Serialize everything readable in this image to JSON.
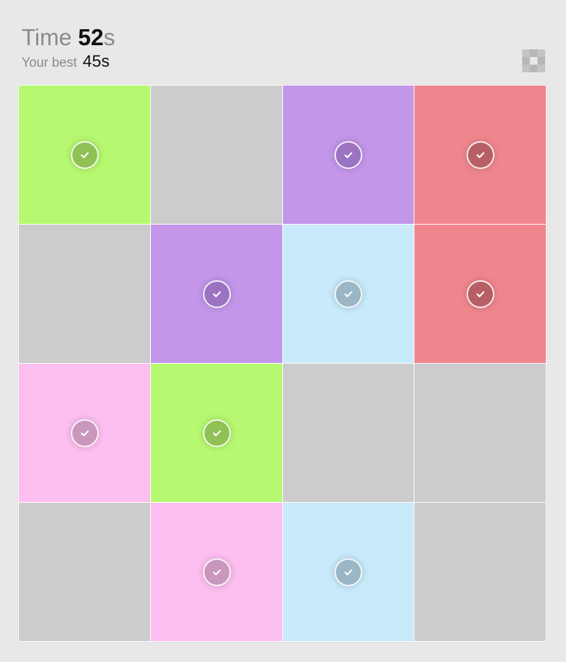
{
  "header": {
    "time_label": "Time",
    "time_value": "52",
    "time_unit": "s",
    "best_label": "Your best",
    "best_value": "45s"
  },
  "menu": {
    "icon": "grid-menu-icon",
    "color": "#c4c4c4"
  },
  "colors": {
    "green": "#b6f970",
    "purple": "#c396ea",
    "red": "#f0868d",
    "blue": "#c8eafb",
    "pink": "#fdbef0",
    "gray": "#cccccc"
  },
  "check_colors": {
    "green": "#8fc155",
    "purple": "#9b73c2",
    "red": "#b85f66",
    "blue": "#9bb6c6",
    "pink": "#c996bd"
  },
  "board": {
    "rows": 4,
    "cols": 4,
    "tiles": [
      {
        "color": "green",
        "matched": true
      },
      {
        "color": "gray",
        "matched": false
      },
      {
        "color": "purple",
        "matched": true
      },
      {
        "color": "red",
        "matched": true
      },
      {
        "color": "gray",
        "matched": false
      },
      {
        "color": "purple",
        "matched": true
      },
      {
        "color": "blue",
        "matched": true
      },
      {
        "color": "red",
        "matched": true
      },
      {
        "color": "pink",
        "matched": true
      },
      {
        "color": "green",
        "matched": true
      },
      {
        "color": "gray",
        "matched": false
      },
      {
        "color": "gray",
        "matched": false
      },
      {
        "color": "gray",
        "matched": false
      },
      {
        "color": "pink",
        "matched": true
      },
      {
        "color": "blue",
        "matched": true
      },
      {
        "color": "gray",
        "matched": false
      }
    ]
  }
}
